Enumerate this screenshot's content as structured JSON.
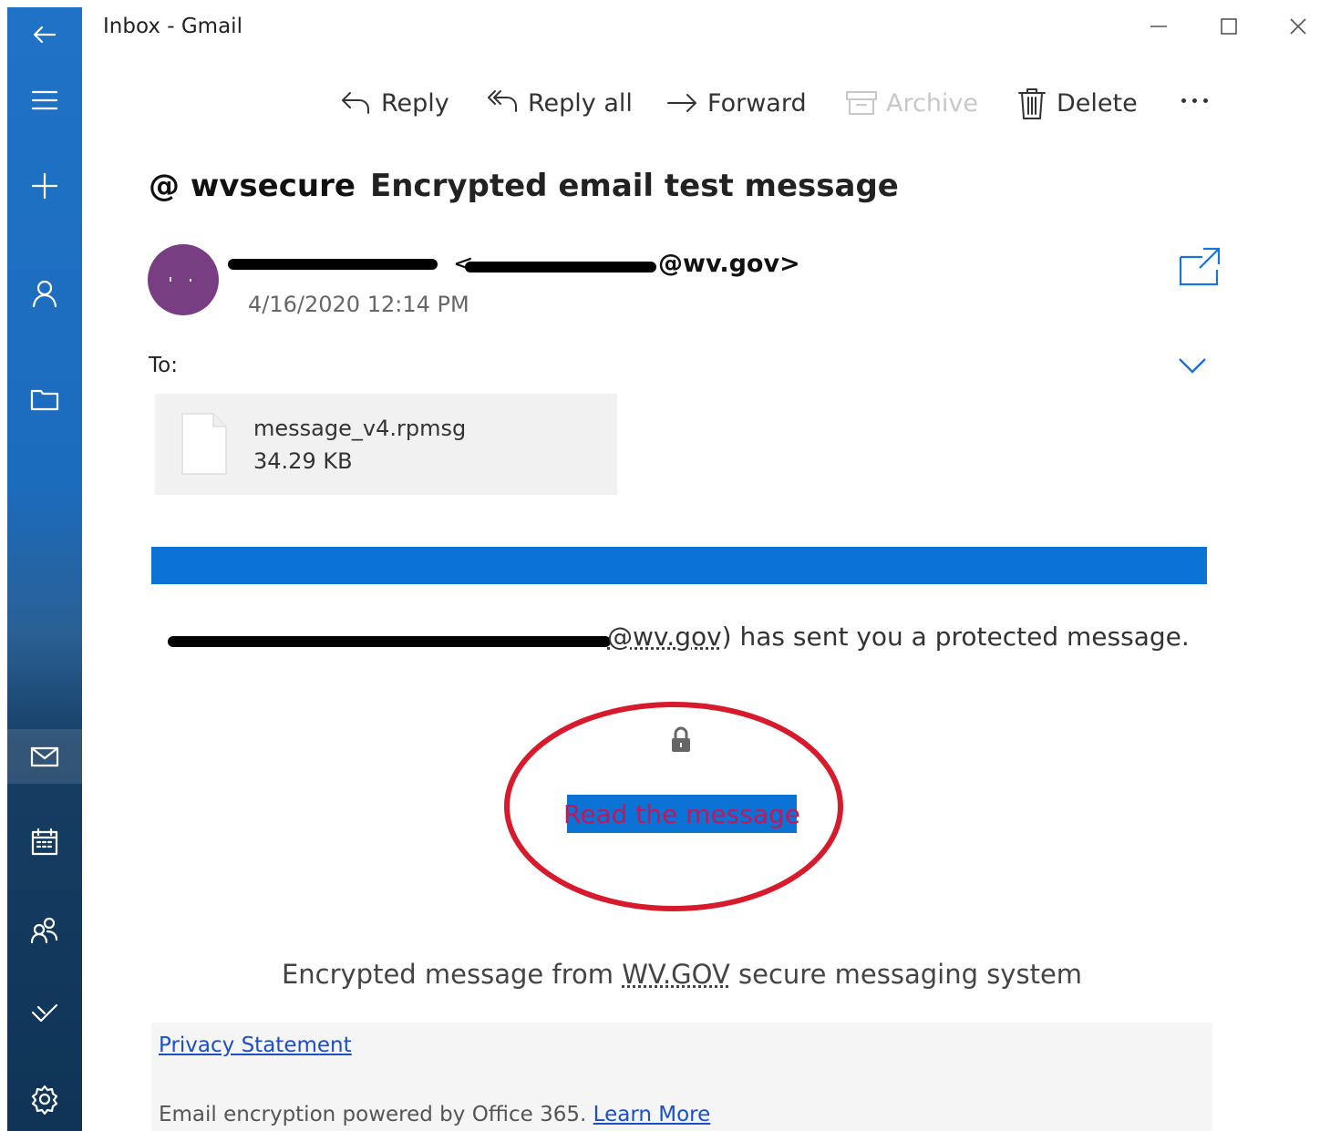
{
  "window": {
    "title": "Inbox - Gmail"
  },
  "toolbar": {
    "reply": "Reply",
    "reply_all": "Reply all",
    "forward": "Forward",
    "archive": "Archive",
    "delete": "Delete"
  },
  "message": {
    "subject_tag": "@ wvsecure",
    "subject": "Encrypted email test message",
    "sender_open": "<",
    "sender_domain": "@wv.gov>",
    "date": "4/16/2020 12:14 PM",
    "to_label": "To:"
  },
  "attachment": {
    "name": "message_v4.rpmsg",
    "size": "34.29 KB"
  },
  "body": {
    "sender_domain": "@wv.gov",
    "protected_text": ") has sent you a protected message.",
    "read_button": "Read the message",
    "enc_prefix": "Encrypted message from ",
    "enc_org": "WV.GOV",
    "enc_suffix": " secure messaging system"
  },
  "footer": {
    "privacy": "Privacy Statement",
    "powered": "Email encryption powered by Office 365. ",
    "learn_more": "Learn More"
  },
  "colors": {
    "accent": "#0b72d6",
    "avatar": "#773e81",
    "annotation": "#d81b2c"
  }
}
